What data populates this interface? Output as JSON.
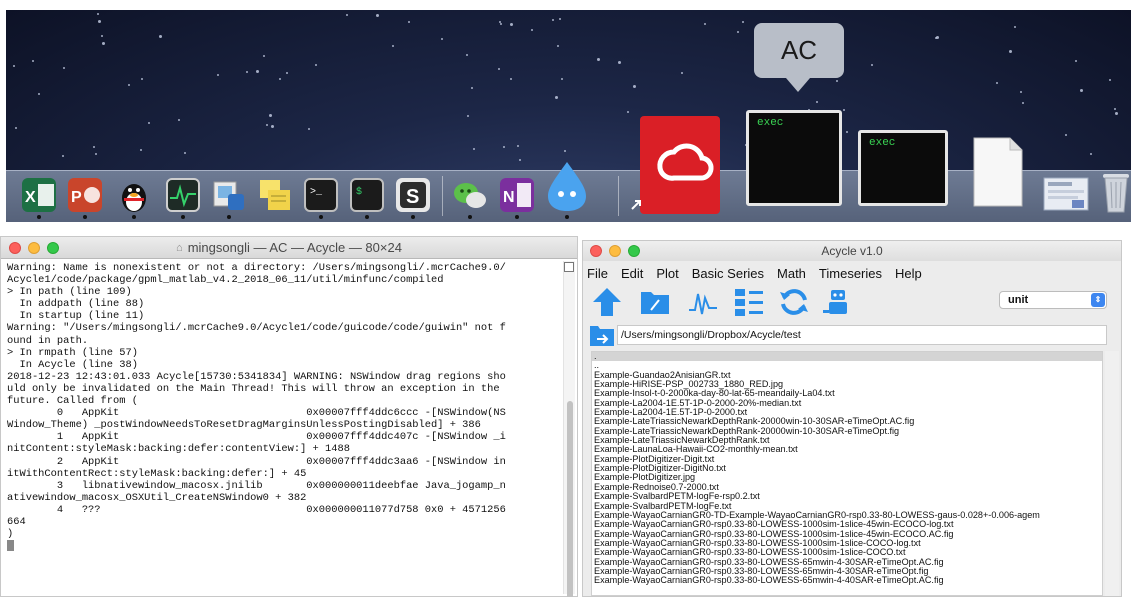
{
  "dock": {
    "tooltip": "AC",
    "thumbnails": [
      {
        "label": "exec"
      },
      {
        "label": "exec"
      }
    ]
  },
  "terminal": {
    "title": "mingsongli — AC — Acycle — 80×24",
    "lines": [
      "Warning: Name is nonexistent or not a directory: /Users/mingsongli/.mcrCache9.0/",
      "Acycle1/code/package/gpml_matlab_v4.2_2018_06_11/util/minfunc/compiled",
      "> In path (line 109)",
      "  In addpath (line 88)",
      "  In startup (line 11)",
      "Warning: \"/Users/mingsongli/.mcrCache9.0/Acycle1/code/guicode/code/guiwin\" not f",
      "ound in path.",
      "> In rmpath (line 57)",
      "  In Acycle (line 38)",
      "2018-12-23 12:43:01.033 Acycle[15730:5341834] WARNING: NSWindow drag regions sho",
      "uld only be invalidated on the Main Thread! This will throw an exception in the",
      "future. Called from (",
      "        0   AppKit                              0x00007fff4ddc6ccc -[NSWindow(NS",
      "Window_Theme) _postWindowNeedsToResetDragMarginsUnlessPostingDisabled] + 386",
      "        1   AppKit                              0x00007fff4ddc407c -[NSWindow _i",
      "nitContent:styleMask:backing:defer:contentView:] + 1488",
      "        2   AppKit                              0x00007fff4ddc3aa6 -[NSWindow in",
      "itWithContentRect:styleMask:backing:defer:] + 45",
      "        3   libnativewindow_macosx.jnilib       0x000000011deebfae Java_jogamp_n",
      "ativewindow_macosx_OSXUtil_CreateNSWindow0 + 382",
      "        4   ???                                 0x000000011077d758 0x0 + 4571256",
      "664",
      ")"
    ]
  },
  "acycle": {
    "title": "Acycle v1.0",
    "menu": [
      "File",
      "Edit",
      "Plot",
      "Basic Series",
      "Math",
      "Timeseries",
      "Help"
    ],
    "unit_value": "unit",
    "path": "/Users/mingsongli/Dropbox/Acycle/test",
    "files": [
      ".",
      "..",
      "Example-Guandao2AnisianGR.txt",
      "Example-HiRISE-PSP_002733_1880_RED.jpg",
      "Example-Insol-t-0-2000ka-day-80-lat-65-meandaily-La04.txt",
      "Example-La2004-1E.5T-1P-0-2000-20%-median.txt",
      "Example-La2004-1E.5T-1P-0-2000.txt",
      "Example-LateTriassicNewarkDepthRank-20000win-10-30SAR-eTimeOpt.AC.fig",
      "Example-LateTriassicNewarkDepthRank-20000win-10-30SAR-eTimeOpt.fig",
      "Example-LateTriassicNewarkDepthRank.txt",
      "Example-LaunaLoa-Hawaii-CO2-monthly-mean.txt",
      "Example-PlotDigitizer-Digit.txt",
      "Example-PlotDigitizer-DigitNo.txt",
      "Example-PlotDigitizer.jpg",
      "Example-Rednoise0.7-2000.txt",
      "Example-SvalbardPETM-logFe-rsp0.2.txt",
      "Example-SvalbardPETM-logFe.txt",
      "Example-WayaoCarnianGR0-TD-Example-WayaoCarnianGR0-rsp0.33-80-LOWESS-gaus-0.028+-0.006-agem",
      "Example-WayaoCarnianGR0-rsp0.33-80-LOWESS-1000sim-1slice-45win-ECOCO-log.txt",
      "Example-WayaoCarnianGR0-rsp0.33-80-LOWESS-1000sim-1slice-45win-ECOCO.AC.fig",
      "Example-WayaoCarnianGR0-rsp0.33-80-LOWESS-1000sim-1slice-COCO-log.txt",
      "Example-WayaoCarnianGR0-rsp0.33-80-LOWESS-1000sim-1slice-COCO.txt",
      "Example-WayaoCarnianGR0-rsp0.33-80-LOWESS-65mwin-4-30SAR-eTimeOpt.AC.fig",
      "Example-WayaoCarnianGR0-rsp0.33-80-LOWESS-65mwin-4-30SAR-eTimeOpt.fig",
      "Example-WayaoCarnianGR0-rsp0.33-80-LOWESS-65mwin-4-40SAR-eTimeOpt.AC.fig"
    ]
  }
}
